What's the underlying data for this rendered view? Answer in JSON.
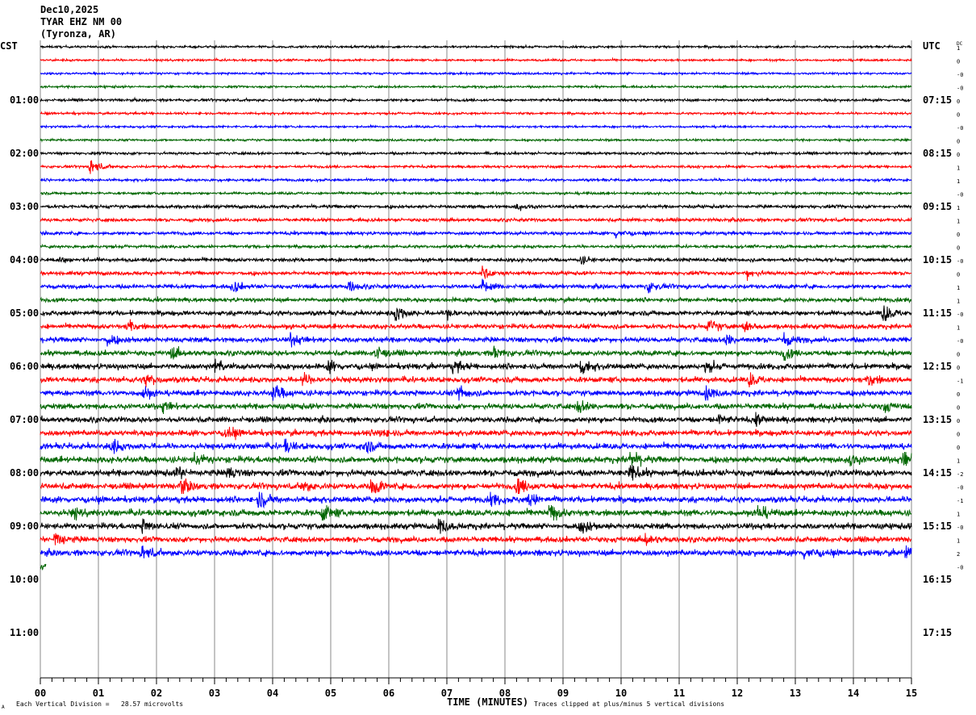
{
  "header": {
    "date": "Dec10,2025",
    "station": "TYAR EHZ NM 00",
    "location": "(Tyronza, AR)"
  },
  "left_axis_title": "CST",
  "right_axis_title": "UTC",
  "dc_title": "DC",
  "footer": {
    "scale_note": "Each Vertical Division =   28.57 microvolts",
    "x_title": "TIME (MINUTES)",
    "clip_note": "Traces clipped at plus/minus 5 vertical divisions",
    "corner_mark": "A"
  },
  "chart_data": {
    "type": "line",
    "subtype": "helicorder",
    "xlabel": "TIME (MINUTES)",
    "xlim": [
      0,
      15
    ],
    "x_ticks": [
      "00",
      "01",
      "02",
      "03",
      "04",
      "05",
      "06",
      "07",
      "08",
      "09",
      "10",
      "11",
      "12",
      "13",
      "14",
      "15"
    ],
    "left_hour_labels": [
      "01:00",
      "02:00",
      "03:00",
      "04:00",
      "05:00",
      "06:00",
      "07:00",
      "08:00",
      "09:00",
      "10:00",
      "11:00"
    ],
    "right_hour_labels": [
      "07:15",
      "08:15",
      "09:15",
      "10:15",
      "11:15",
      "12:15",
      "13:15",
      "14:15",
      "15:15",
      "16:15",
      "17:15"
    ],
    "trace_minutes_per_line": 15,
    "trace_colors": [
      "#000000",
      "#ff0000",
      "#0000ff",
      "#006600"
    ],
    "grid_color": "#888888",
    "clip_divisions": 5,
    "dc_offsets": [
      "1",
      "0",
      "-0",
      "-0",
      "0",
      "0",
      "-0",
      "0",
      "0",
      "1",
      "1",
      "-0",
      "1",
      "1",
      "0",
      "0",
      "-0",
      "0",
      "1",
      "1",
      "-0",
      "1",
      "-0",
      "0",
      "0",
      "-1",
      "0",
      "0",
      "0",
      "0",
      "0",
      "1",
      "-2",
      "-0",
      "-1",
      "1",
      "-0",
      "1",
      "2",
      "-0"
    ],
    "last_line_end_minute": 0.1,
    "noise_divisions": [
      0.6,
      0.6,
      0.6,
      0.6,
      0.7,
      0.6,
      0.6,
      0.6,
      0.7,
      0.7,
      0.7,
      0.7,
      0.9,
      0.9,
      0.9,
      0.8,
      1.0,
      1.0,
      1.1,
      1.1,
      1.3,
      1.3,
      1.4,
      1.4,
      1.5,
      1.5,
      1.5,
      1.5,
      1.5,
      1.5,
      1.6,
      1.7,
      1.7,
      1.6,
      1.6,
      1.7,
      1.6,
      1.5,
      1.6,
      1.5
    ],
    "events": [
      {
        "line": 9,
        "minute": 0.86,
        "amp": 4.5
      },
      {
        "line": 12,
        "minute": 8.2,
        "amp": 2
      },
      {
        "line": 14,
        "minute": 9.9,
        "amp": 2.5
      },
      {
        "line": 16,
        "minute": 0.3,
        "amp": 2
      },
      {
        "line": 16,
        "minute": 9.3,
        "amp": 2
      },
      {
        "line": 17,
        "minute": 7.6,
        "amp": 3.5
      },
      {
        "line": 17,
        "minute": 12.15,
        "amp": 3
      },
      {
        "line": 18,
        "minute": 3.3,
        "amp": 3
      },
      {
        "line": 18,
        "minute": 5.3,
        "amp": 3
      },
      {
        "line": 18,
        "minute": 7.6,
        "amp": 3.5
      },
      {
        "line": 18,
        "minute": 10.45,
        "amp": 3
      },
      {
        "line": 20,
        "minute": 6.1,
        "amp": 5
      },
      {
        "line": 20,
        "minute": 7.0,
        "amp": 2.5
      },
      {
        "line": 20,
        "minute": 14.5,
        "amp": 5
      },
      {
        "line": 21,
        "minute": 1.5,
        "amp": 3
      },
      {
        "line": 21,
        "minute": 11.5,
        "amp": 3.5
      },
      {
        "line": 21,
        "minute": 12.1,
        "amp": 3
      },
      {
        "line": 22,
        "minute": 1.15,
        "amp": 3
      },
      {
        "line": 22,
        "minute": 4.3,
        "amp": 3
      },
      {
        "line": 22,
        "minute": 11.8,
        "amp": 3
      },
      {
        "line": 22,
        "minute": 12.8,
        "amp": 3
      },
      {
        "line": 23,
        "minute": 2.25,
        "amp": 3
      },
      {
        "line": 23,
        "minute": 5.75,
        "amp": 4
      },
      {
        "line": 23,
        "minute": 7.8,
        "amp": 3.5
      },
      {
        "line": 23,
        "minute": 12.8,
        "amp": 3
      },
      {
        "line": 24,
        "minute": 3.0,
        "amp": 3
      },
      {
        "line": 24,
        "minute": 4.95,
        "amp": 3
      },
      {
        "line": 24,
        "minute": 7.1,
        "amp": 3
      },
      {
        "line": 24,
        "minute": 9.3,
        "amp": 5
      },
      {
        "line": 24,
        "minute": 11.45,
        "amp": 3
      },
      {
        "line": 25,
        "minute": 1.8,
        "amp": 3.5
      },
      {
        "line": 25,
        "minute": 4.5,
        "amp": 3
      },
      {
        "line": 25,
        "minute": 12.2,
        "amp": 3.5
      },
      {
        "line": 25,
        "minute": 14.25,
        "amp": 3.5
      },
      {
        "line": 26,
        "minute": 1.75,
        "amp": 3.5
      },
      {
        "line": 26,
        "minute": 4.0,
        "amp": 5
      },
      {
        "line": 26,
        "minute": 7.2,
        "amp": 4
      },
      {
        "line": 26,
        "minute": 11.45,
        "amp": 3.5
      },
      {
        "line": 27,
        "minute": 2.1,
        "amp": 2.5
      },
      {
        "line": 27,
        "minute": 9.25,
        "amp": 3.5
      },
      {
        "line": 27,
        "minute": 14.5,
        "amp": 3
      },
      {
        "line": 28,
        "minute": 11.65,
        "amp": 2.5
      },
      {
        "line": 28,
        "minute": 12.3,
        "amp": 3.5
      },
      {
        "line": 29,
        "minute": 3.2,
        "amp": 3
      },
      {
        "line": 29,
        "minute": 5.8,
        "amp": 3
      },
      {
        "line": 30,
        "minute": 1.2,
        "amp": 4
      },
      {
        "line": 30,
        "minute": 4.2,
        "amp": 3
      },
      {
        "line": 30,
        "minute": 5.55,
        "amp": 4
      },
      {
        "line": 31,
        "minute": 2.65,
        "amp": 3
      },
      {
        "line": 31,
        "minute": 10.15,
        "amp": 5
      },
      {
        "line": 31,
        "minute": 13.9,
        "amp": 4
      },
      {
        "line": 31,
        "minute": 14.85,
        "amp": 4
      },
      {
        "line": 32,
        "minute": 2.35,
        "amp": 3
      },
      {
        "line": 32,
        "minute": 3.2,
        "amp": 4
      },
      {
        "line": 32,
        "minute": 10.15,
        "amp": 5
      },
      {
        "line": 33,
        "minute": 2.4,
        "amp": 5
      },
      {
        "line": 33,
        "minute": 4.5,
        "amp": 3
      },
      {
        "line": 33,
        "minute": 5.7,
        "amp": 5
      },
      {
        "line": 33,
        "minute": 8.2,
        "amp": 5
      },
      {
        "line": 34,
        "minute": 3.75,
        "amp": 5
      },
      {
        "line": 34,
        "minute": 7.75,
        "amp": 3
      },
      {
        "line": 34,
        "minute": 8.4,
        "amp": 3.5
      },
      {
        "line": 35,
        "minute": 0.55,
        "amp": 3
      },
      {
        "line": 35,
        "minute": 4.85,
        "amp": 5
      },
      {
        "line": 35,
        "minute": 8.75,
        "amp": 5
      },
      {
        "line": 35,
        "minute": 12.35,
        "amp": 4
      },
      {
        "line": 36,
        "minute": 1.75,
        "amp": 3
      },
      {
        "line": 36,
        "minute": 6.85,
        "amp": 4
      },
      {
        "line": 36,
        "minute": 9.3,
        "amp": 4
      },
      {
        "line": 37,
        "minute": 0.25,
        "amp": 5
      },
      {
        "line": 37,
        "minute": 10.4,
        "amp": 3
      },
      {
        "line": 38,
        "minute": 1.75,
        "amp": 4
      },
      {
        "line": 38,
        "minute": 13.15,
        "amp": 3.5
      },
      {
        "line": 38,
        "minute": 14.9,
        "amp": 4
      }
    ]
  }
}
